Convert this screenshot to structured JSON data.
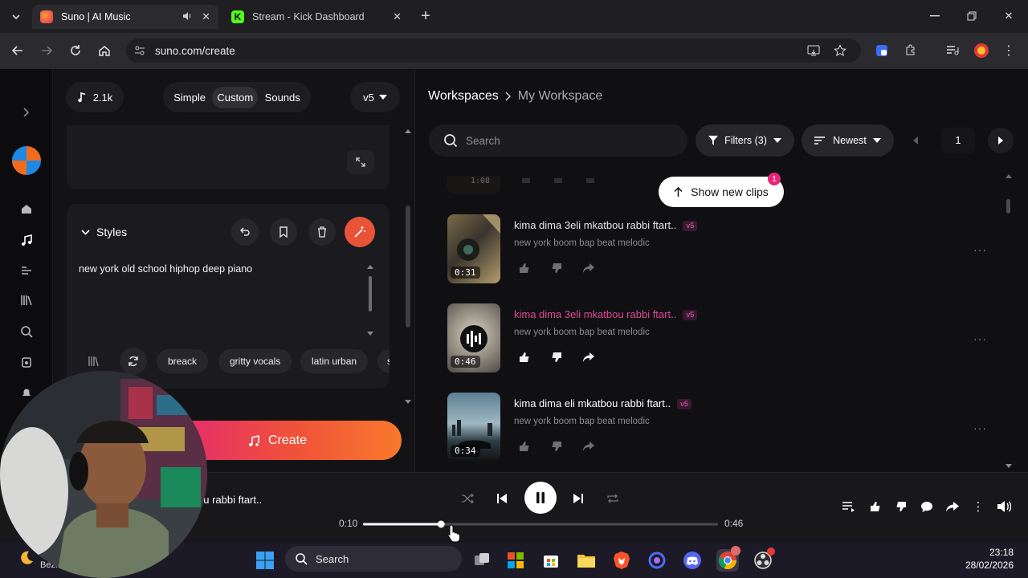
{
  "browser": {
    "tabs": [
      {
        "title": "Suno | AI Music",
        "active": true
      },
      {
        "title": "Stream - Kick Dashboard",
        "active": false
      }
    ],
    "url": "suno.com/create"
  },
  "left_panel": {
    "credits": "2.1k",
    "modes": [
      "Simple",
      "Custom",
      "Sounds"
    ],
    "selected_mode": "Custom",
    "version": "v5",
    "styles_label": "Styles",
    "styles_text": "new york old school hiphop deep piano",
    "style_chips": [
      "breack",
      "gritty vocals",
      "latin urban",
      "s"
    ],
    "create_label": "Create"
  },
  "workspace": {
    "breadcrumb_root": "Workspaces",
    "breadcrumb_current": "My Workspace",
    "search_placeholder": "Search",
    "filters_label": "Filters (3)",
    "sort_label": "Newest",
    "page": "1",
    "show_new_label": "Show new clips",
    "show_new_count": "1",
    "partial_duration": "1:08",
    "clips": [
      {
        "title": "kima dima 3eli mkatbou rabbi ftart..",
        "version": "v5",
        "style": "new york boom bap beat melodic",
        "duration": "0:31",
        "playing": false
      },
      {
        "title": "kima dima 3eli mkatbou rabbi ftart..",
        "version": "v5",
        "style": "new york boom bap beat melodic",
        "duration": "0:46",
        "playing": true
      },
      {
        "title": "kima dima eli mkatbou rabbi ftart..",
        "version": "v5",
        "style": "new york boom bap beat melodic",
        "duration": "0:34",
        "playing": false
      }
    ]
  },
  "player": {
    "track_title_partial": "ou rabbi ftart..",
    "current_time": "0:10",
    "total_time": "0:46",
    "progress": 0.22
  },
  "taskbar": {
    "search_label": "Search",
    "weather_partial": "Bezn",
    "time": "23:18",
    "date": "28/02/2026"
  }
}
